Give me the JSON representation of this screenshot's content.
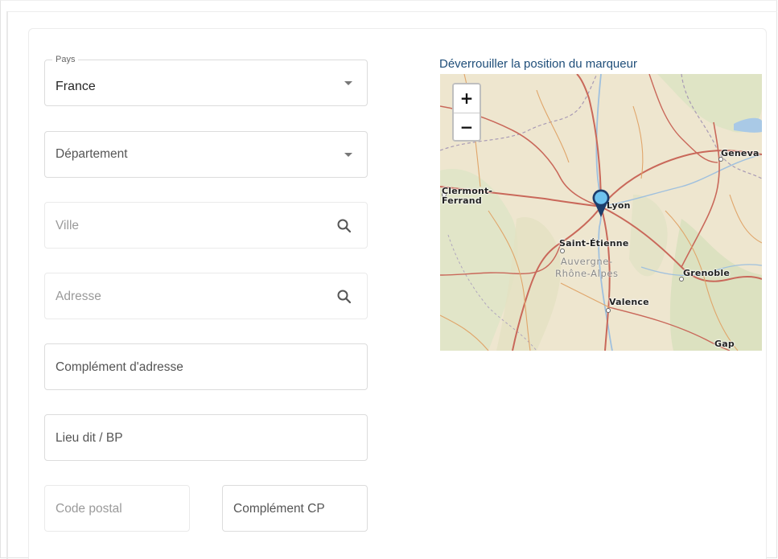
{
  "form": {
    "country": {
      "legend": "Pays",
      "value": "France"
    },
    "department": {
      "placeholder": "Département"
    },
    "city": {
      "placeholder": "Ville"
    },
    "address": {
      "placeholder": "Adresse"
    },
    "address_complement": {
      "placeholder": "Complément d'adresse"
    },
    "locality": {
      "placeholder": "Lieu dit / BP"
    },
    "postal_code": {
      "placeholder": "Code postal"
    },
    "postal_complement": {
      "placeholder": "Complément CP"
    }
  },
  "map": {
    "caption": "Déverrouiller la position du marqueur",
    "zoom_in": "+",
    "zoom_out": "−",
    "cities": {
      "clermont": "Clermont-\nFerrand",
      "lyon": "Lyon",
      "saint_etienne": "Saint-Étienne",
      "geneva": "Geneva",
      "grenoble": "Grenoble",
      "valence": "Valence",
      "gap": "Gap"
    },
    "region": "Auvergne-\nRhône-Alpes",
    "marker_color": "#6ec3ef"
  },
  "colors": {
    "link": "#1f4e79",
    "border": "#dcdcdc"
  }
}
